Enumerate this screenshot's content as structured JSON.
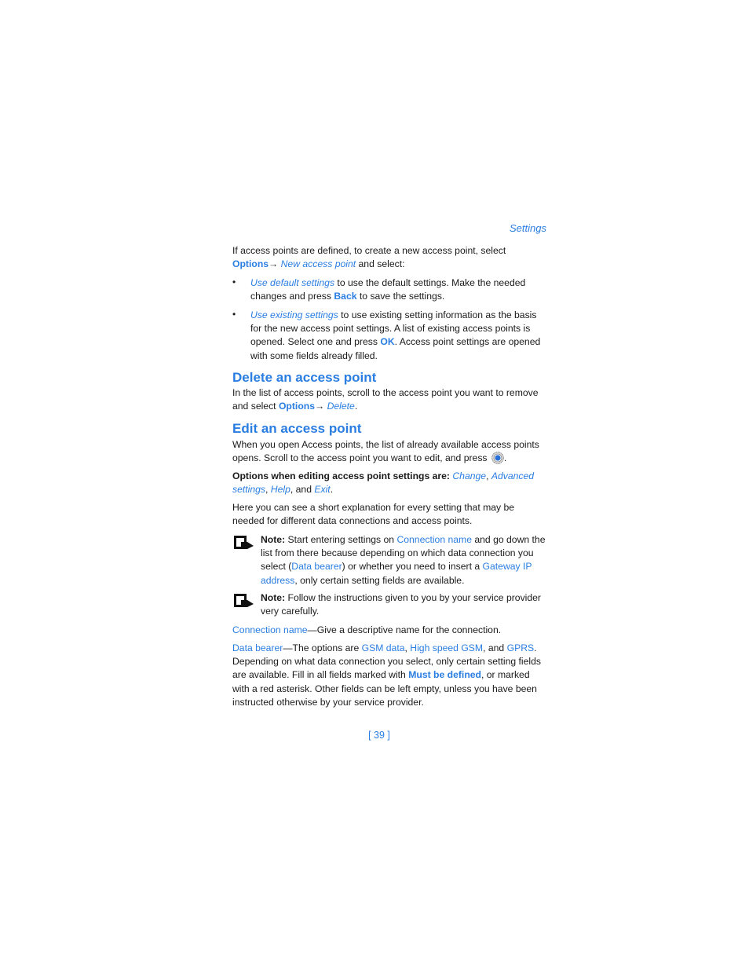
{
  "header": {
    "section": "Settings"
  },
  "intro": {
    "text1": "If access points are defined, to create a new access point, select",
    "options": "Options",
    "arrow": "→",
    "new_ap": "New access point",
    "text2": " and select:"
  },
  "bullets": [
    {
      "link": "Use default settings",
      "text1": " to use the default settings. Make the needed changes and press ",
      "key": "Back",
      "text2": " to save the settings."
    },
    {
      "link": "Use existing settings",
      "text1": " to use existing setting information as the basis for the new access point settings. A list of existing access points is opened. Select one and press ",
      "key": "OK",
      "text2": ". Access point settings are opened with some fields already filled."
    }
  ],
  "delete_section": {
    "heading": "Delete an access point",
    "text1": "In the list of access points, scroll to the access point you want to remove and select ",
    "options": "Options",
    "arrow": "→ ",
    "delete": "Delete",
    "end": "."
  },
  "edit_section": {
    "heading": "Edit an access point",
    "text1": "When you open Access points, the list of already available access points opens. Scroll to the access point you want to edit, and press ",
    "end": ".",
    "options_label": "Options when editing access point settings are: ",
    "opt_change": "Change",
    "opt_advanced": "Advanced settings",
    "opt_help": "Help",
    "opt_exit": "Exit",
    "sep1": ", ",
    "sep2": ", ",
    "and": ", and ",
    "period": ".",
    "explanation": "Here you can see a short explanation for every setting that may be needed for different data connections and access points."
  },
  "notes": [
    {
      "label": "Note:",
      "t1": " Start entering settings on ",
      "l1": "Connection name",
      "t2": " and go down the list from there because depending on which data connection you select (",
      "l2": "Data bearer",
      "t3": ") or whether you need to insert a ",
      "l3": "Gateway IP address",
      "t4": ", only certain setting fields are available."
    },
    {
      "label": "Note:",
      "t1": " Follow the instructions given to you by your service provider very carefully."
    }
  ],
  "connection_name": {
    "term": "Connection name",
    "desc": "—Give a descriptive name for the connection."
  },
  "data_bearer": {
    "term": "Data bearer",
    "t1": "—The options are ",
    "o1": "GSM data",
    "s1": ", ",
    "o2": "High speed GSM",
    "s2": ", and ",
    "o3": "GPRS",
    "t2": ". Depending on what data connection you select, only certain setting fields are available. Fill in all fields marked with ",
    "must": "Must be defined",
    "t3": ", or marked with a red asterisk. Other fields can be left empty, unless you have been instructed otherwise by your service provider."
  },
  "footer": {
    "page_number": "[ 39 ]"
  },
  "icons": {
    "note": "note-icon",
    "joystick": "joystick-icon"
  },
  "colors": {
    "accent": "#2a7de1",
    "text": "#1a1a1a"
  }
}
